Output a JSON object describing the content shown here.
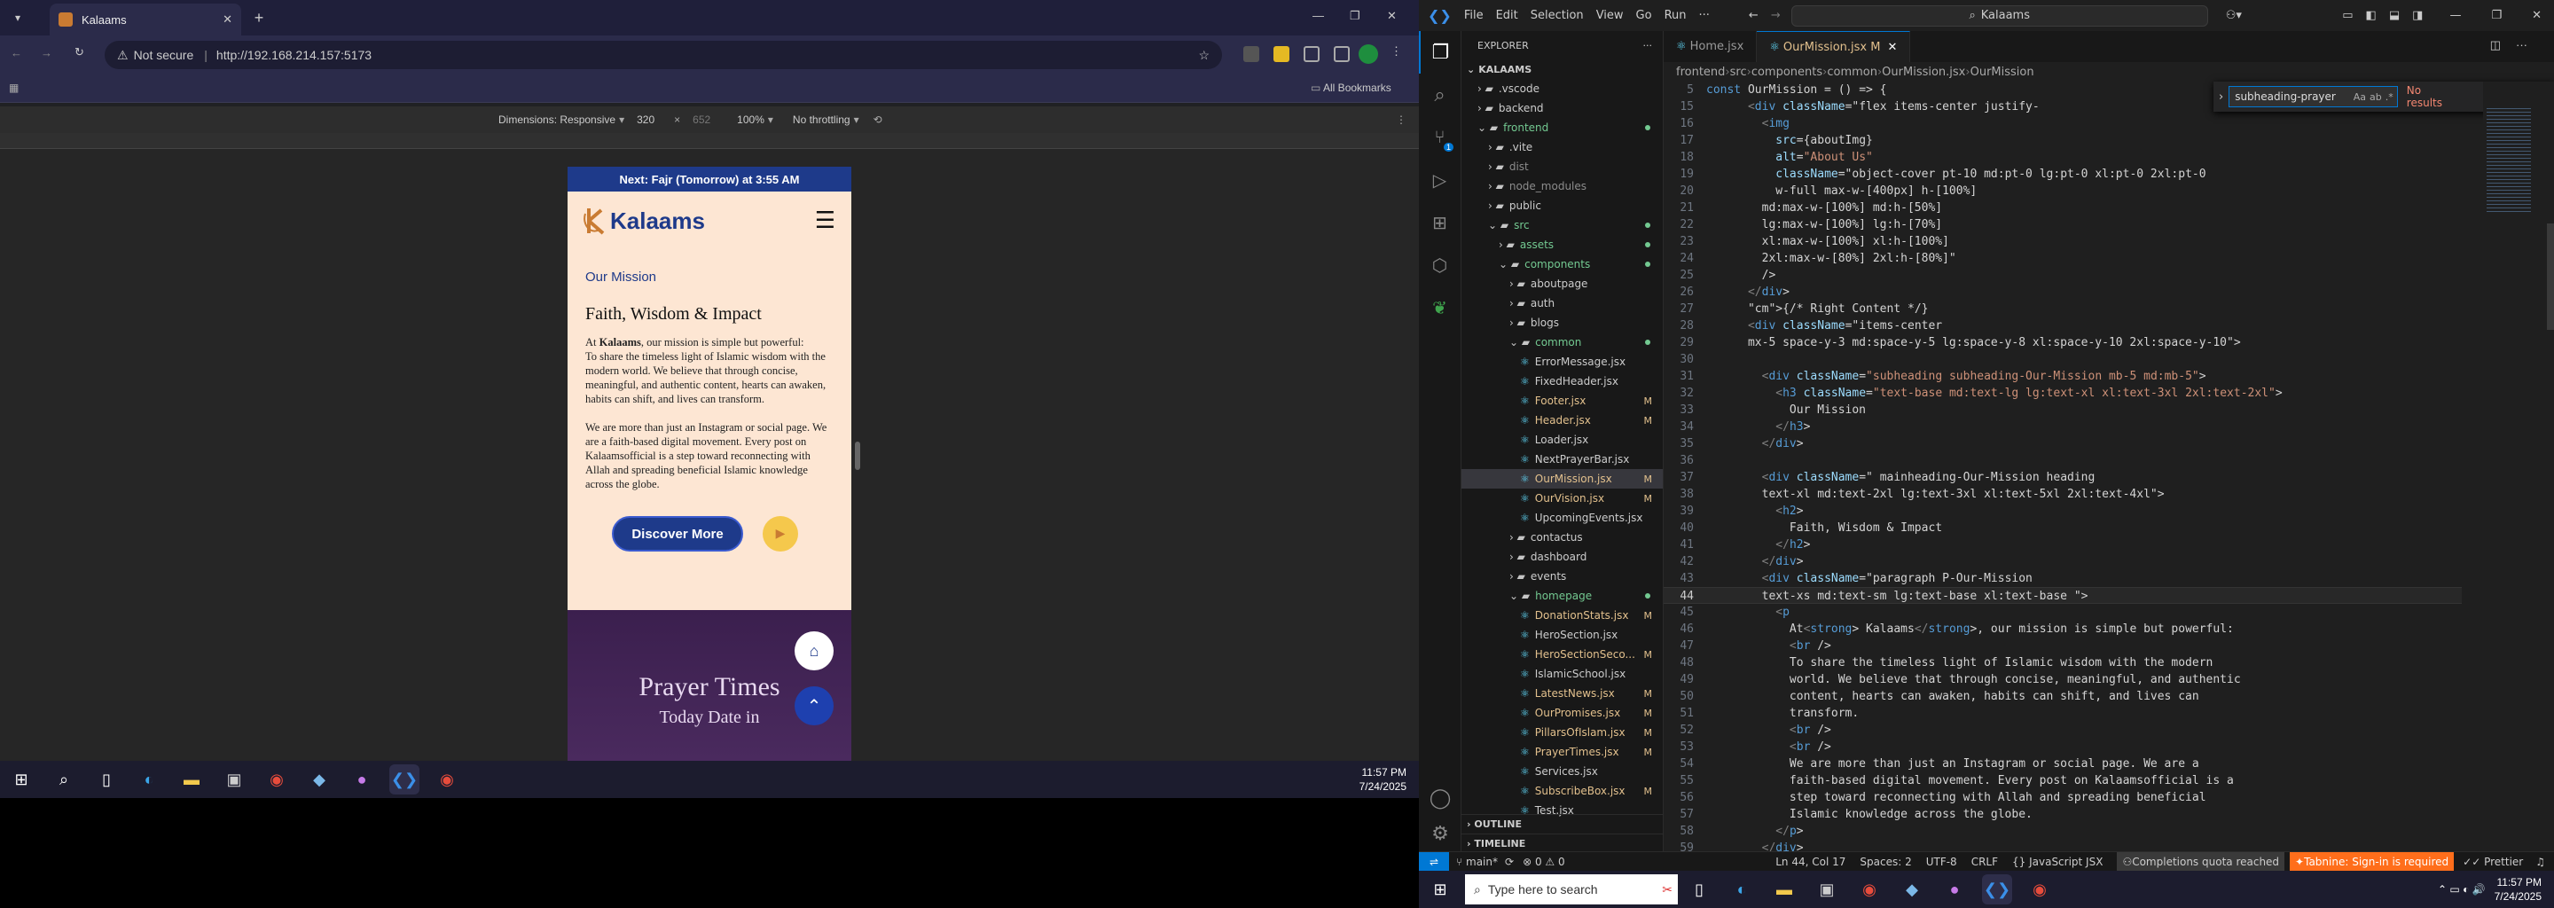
{
  "browser": {
    "tab_title": "Kalaams",
    "url": "http://192.168.214.157:5173",
    "not_secure": "Not secure",
    "all_bookmarks": "All Bookmarks",
    "devtools": {
      "dimensions_label": "Dimensions: Responsive",
      "width": "320",
      "x": "×",
      "height": "652",
      "zoom": "100%",
      "throttling": "No throttling"
    }
  },
  "site": {
    "next_prayer": "Next: Fajr (Tomorrow) at 3:55 AM",
    "logo_text": "Kalaams",
    "section_label": "Our Mission",
    "heading": "Faith, Wisdom & Impact",
    "para1_pre": "At ",
    "para1_bold": "Kalaams",
    "para1_post": ", our mission is simple but powerful:",
    "para2": "To share the timeless light of Islamic wisdom with the modern world. We believe that through concise, meaningful, and authentic content, hearts can awaken, habits can shift, and lives can transform.",
    "para3": "We are more than just an Instagram or social page. We are a faith-based digital movement. Every post on Kalaamsofficial is a step toward reconnecting with Allah and spreading beneficial Islamic knowledge across the globe.",
    "discover_button": "Discover More",
    "prayer_heading": "Prayer Times",
    "prayer_sub": "Today Date in"
  },
  "taskbar_left": {
    "time": "11:57 PM",
    "date": "7/24/2025"
  },
  "vscode": {
    "menu": [
      "File",
      "Edit",
      "Selection",
      "View",
      "Go",
      "Run",
      "···"
    ],
    "search_box": "Kalaams",
    "explorer_title": "EXPLORER",
    "root": "KALAAMS",
    "tree": [
      {
        "name": ".vscode",
        "depth": 1,
        "type": "folder-closed"
      },
      {
        "name": "backend",
        "depth": 1,
        "type": "folder-closed"
      },
      {
        "name": "frontend",
        "depth": 1,
        "type": "folder-open",
        "badge": "dot"
      },
      {
        "name": ".vite",
        "depth": 2,
        "type": "folder-closed"
      },
      {
        "name": "dist",
        "depth": 2,
        "type": "folder-closed",
        "dim": true
      },
      {
        "name": "node_modules",
        "depth": 2,
        "type": "folder-closed",
        "dim": true
      },
      {
        "name": "public",
        "depth": 2,
        "type": "folder-closed"
      },
      {
        "name": "src",
        "depth": 2,
        "type": "folder-open",
        "badge": "dot"
      },
      {
        "name": "assets",
        "depth": 3,
        "type": "folder-closed",
        "badge": "dot"
      },
      {
        "name": "components",
        "depth": 3,
        "type": "folder-open",
        "badge": "dot"
      },
      {
        "name": "aboutpage",
        "depth": 4,
        "type": "folder-closed"
      },
      {
        "name": "auth",
        "depth": 4,
        "type": "folder-closed"
      },
      {
        "name": "blogs",
        "depth": 4,
        "type": "folder-closed"
      },
      {
        "name": "common",
        "depth": 4,
        "type": "folder-open",
        "badge": "dot"
      },
      {
        "name": "ErrorMessage.jsx",
        "depth": 5,
        "type": "file"
      },
      {
        "name": "FixedHeader.jsx",
        "depth": 5,
        "type": "file"
      },
      {
        "name": "Footer.jsx",
        "depth": 5,
        "type": "file",
        "badge": "M"
      },
      {
        "name": "Header.jsx",
        "depth": 5,
        "type": "file",
        "badge": "M"
      },
      {
        "name": "Loader.jsx",
        "depth": 5,
        "type": "file"
      },
      {
        "name": "NextPrayerBar.jsx",
        "depth": 5,
        "type": "file"
      },
      {
        "name": "OurMission.jsx",
        "depth": 5,
        "type": "file",
        "badge": "M",
        "selected": true
      },
      {
        "name": "OurVision.jsx",
        "depth": 5,
        "type": "file",
        "badge": "M"
      },
      {
        "name": "UpcomingEvents.jsx",
        "depth": 5,
        "type": "file"
      },
      {
        "name": "contactus",
        "depth": 4,
        "type": "folder-closed"
      },
      {
        "name": "dashboard",
        "depth": 4,
        "type": "folder-closed"
      },
      {
        "name": "events",
        "depth": 4,
        "type": "folder-closed"
      },
      {
        "name": "homepage",
        "depth": 4,
        "type": "folder-open",
        "badge": "dot"
      },
      {
        "name": "DonationStats.jsx",
        "depth": 5,
        "type": "file",
        "badge": "M"
      },
      {
        "name": "HeroSection.jsx",
        "depth": 5,
        "type": "file"
      },
      {
        "name": "HeroSectionSeco...",
        "depth": 5,
        "type": "file",
        "badge": "M"
      },
      {
        "name": "IslamicSchool.jsx",
        "depth": 5,
        "type": "file"
      },
      {
        "name": "LatestNews.jsx",
        "depth": 5,
        "type": "file",
        "badge": "M"
      },
      {
        "name": "OurPromises.jsx",
        "depth": 5,
        "type": "file",
        "badge": "M"
      },
      {
        "name": "PillarsOfIslam.jsx",
        "depth": 5,
        "type": "file",
        "badge": "M"
      },
      {
        "name": "PrayerTimes.jsx",
        "depth": 5,
        "type": "file",
        "badge": "M"
      },
      {
        "name": "Services.jsx",
        "depth": 5,
        "type": "file"
      },
      {
        "name": "SubscribeBox.jsx",
        "depth": 5,
        "type": "file",
        "badge": "M"
      },
      {
        "name": "Test.jsx",
        "depth": 5,
        "type": "file"
      }
    ],
    "outline": "OUTLINE",
    "timeline": "TIMELINE",
    "tabs": [
      {
        "label": "Home.jsx",
        "active": false
      },
      {
        "label": "OurMission.jsx M",
        "active": true
      }
    ],
    "breadcrumb": [
      "frontend",
      "src",
      "components",
      "common",
      "OurMission.jsx",
      "OurMission"
    ],
    "find": {
      "query": "subheading-prayer",
      "result": "No results"
    },
    "code_lines": [
      {
        "n": "5",
        "t": "const OurMission = () => {"
      },
      {
        "n": "15",
        "t": "      <div className=\"flex items-center justify-"
      },
      {
        "n": "16",
        "t": "        <img"
      },
      {
        "n": "17",
        "t": "          src={aboutImg}"
      },
      {
        "n": "18",
        "t": "          alt=\"About Us\""
      },
      {
        "n": "19",
        "t": "          className=\"object-cover pt-10 md:pt-0 lg:pt-0 xl:pt-0 2xl:pt-0"
      },
      {
        "n": "20",
        "t": "          w-full max-w-[400px] h-[100%]"
      },
      {
        "n": "21",
        "t": "        md:max-w-[100%] md:h-[50%]"
      },
      {
        "n": "22",
        "t": "        lg:max-w-[100%] lg:h-[70%]"
      },
      {
        "n": "23",
        "t": "        xl:max-w-[100%] xl:h-[100%]"
      },
      {
        "n": "24",
        "t": "        2xl:max-w-[80%] 2xl:h-[80%]\""
      },
      {
        "n": "25",
        "t": "        />"
      },
      {
        "n": "26",
        "t": "      </div>"
      },
      {
        "n": "27",
        "t": "      {/* Right Content */}"
      },
      {
        "n": "28",
        "t": "      <div className=\"items-center"
      },
      {
        "n": "29",
        "t": "      mx-5 space-y-3 md:space-y-5 lg:space-y-8 xl:space-y-10 2xl:space-y-10\">"
      },
      {
        "n": "30",
        "t": ""
      },
      {
        "n": "31",
        "t": "        <div className=\"subheading subheading-Our-Mission mb-5 md:mb-5\">"
      },
      {
        "n": "32",
        "t": "          <h3 className=\"text-base md:text-lg lg:text-xl xl:text-3xl 2xl:text-2xl\">"
      },
      {
        "n": "33",
        "t": "            Our Mission"
      },
      {
        "n": "34",
        "t": "          </h3>"
      },
      {
        "n": "35",
        "t": "        </div>"
      },
      {
        "n": "36",
        "t": ""
      },
      {
        "n": "37",
        "t": "        <div className=\" mainheading-Our-Mission heading"
      },
      {
        "n": "38",
        "t": "        text-xl md:text-2xl lg:text-3xl xl:text-5xl 2xl:text-4xl\">"
      },
      {
        "n": "39",
        "t": "          <h2>"
      },
      {
        "n": "40",
        "t": "            Faith, Wisdom & Impact"
      },
      {
        "n": "41",
        "t": "          </h2>"
      },
      {
        "n": "42",
        "t": "        </div>"
      },
      {
        "n": "43",
        "t": "        <div className=\"paragraph P-Our-Mission"
      },
      {
        "n": "44",
        "t": "        text-xs md:text-sm lg:text-base xl:text-base \">"
      },
      {
        "n": "45",
        "t": "          <p"
      },
      {
        "n": "46",
        "t": "            At<strong> Kalaams</strong>, our mission is simple but powerful:"
      },
      {
        "n": "47",
        "t": "            <br />"
      },
      {
        "n": "48",
        "t": "            To share the timeless light of Islamic wisdom with the modern"
      },
      {
        "n": "49",
        "t": "            world. We believe that through concise, meaningful, and authentic"
      },
      {
        "n": "50",
        "t": "            content, hearts can awaken, habits can shift, and lives can"
      },
      {
        "n": "51",
        "t": "            transform."
      },
      {
        "n": "52",
        "t": "            <br />"
      },
      {
        "n": "53",
        "t": "            <br />"
      },
      {
        "n": "54",
        "t": "            We are more than just an Instagram or social page. We are a"
      },
      {
        "n": "55",
        "t": "            faith-based digital movement. Every post on Kalaamsofficial is a"
      },
      {
        "n": "56",
        "t": "            step toward reconnecting with Allah and spreading beneficial"
      },
      {
        "n": "57",
        "t": "            Islamic knowledge across the globe."
      },
      {
        "n": "58",
        "t": "          </p>"
      },
      {
        "n": "59",
        "t": "        </div>"
      }
    ],
    "current_line": "44",
    "status": {
      "branch": "main*",
      "errors": "0",
      "warnings": "0",
      "position": "Ln 44, Col 17",
      "spaces": "Spaces: 2",
      "encoding": "UTF-8",
      "eol": "CRLF",
      "language": "JavaScript JSX",
      "quota": "Completions quota reached",
      "tabnine": "Tabnine: Sign-in is required",
      "prettier": "Prettier"
    }
  },
  "taskbar_right": {
    "search_placeholder": "Type here to search",
    "time": "11:57 PM",
    "date": "7/24/2025"
  },
  "colors": {
    "accent": "#0078d4",
    "site_blue": "#1e3a8a",
    "site_bg": "#fde6d3",
    "tabnine": "#ff6e1b"
  }
}
